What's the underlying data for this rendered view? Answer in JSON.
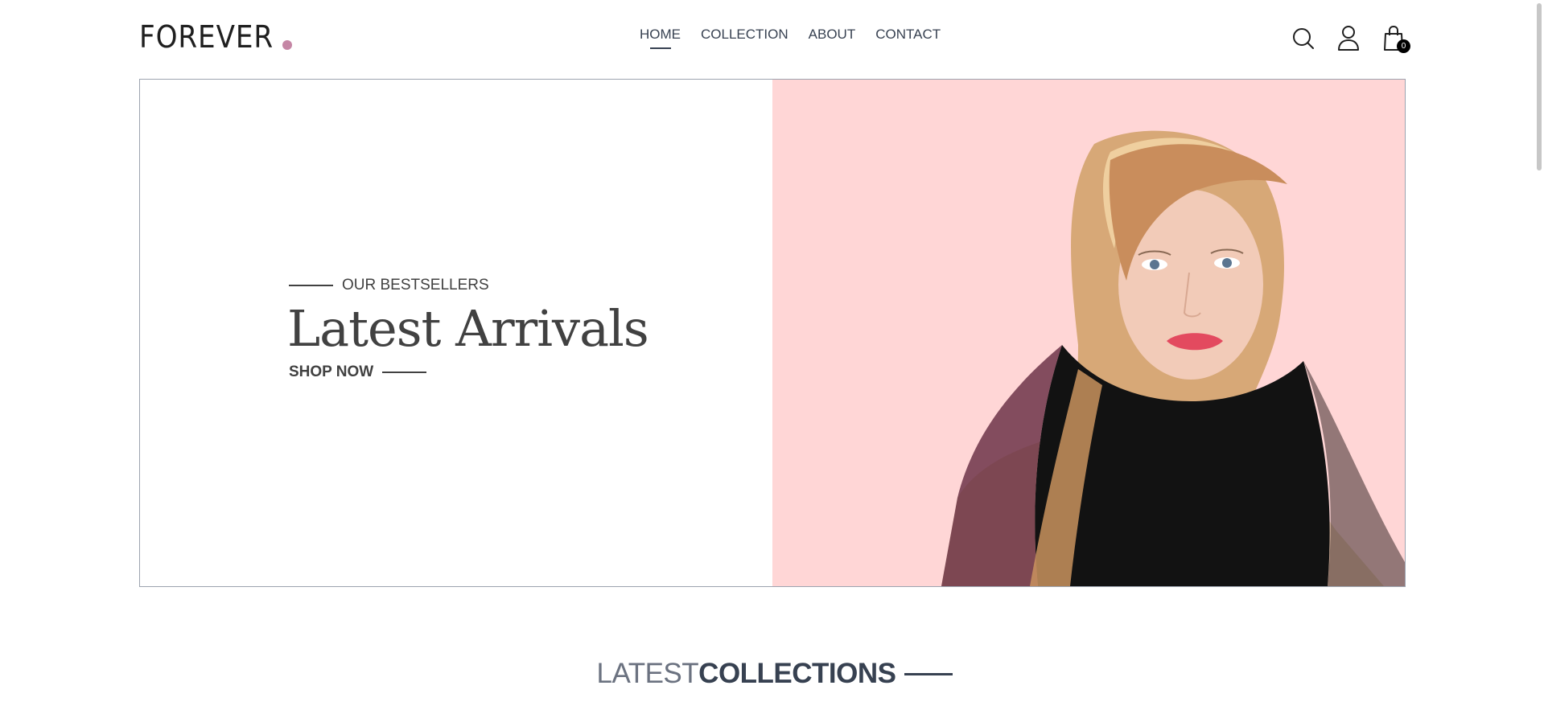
{
  "brand": {
    "logo_text": "FOREVER",
    "dot_color": "#c586a5"
  },
  "nav": {
    "items": [
      {
        "label": "HOME",
        "active": true
      },
      {
        "label": "COLLECTION",
        "active": false
      },
      {
        "label": "ABOUT",
        "active": false
      },
      {
        "label": "CONTACT",
        "active": false
      }
    ]
  },
  "header_icons": {
    "search": "search-icon",
    "profile": "user-icon",
    "cart": "shopping-bag-icon",
    "cart_count": "0"
  },
  "hero": {
    "tagline": "OUR BESTSELLERS",
    "title": "Latest Arrivals",
    "cta": "SHOP NOW",
    "image_bg_color": "#ffd6d6",
    "image_desc_icon": "model-portrait-image"
  },
  "section": {
    "title_light": "LATEST",
    "title_bold": "COLLECTIONS"
  }
}
